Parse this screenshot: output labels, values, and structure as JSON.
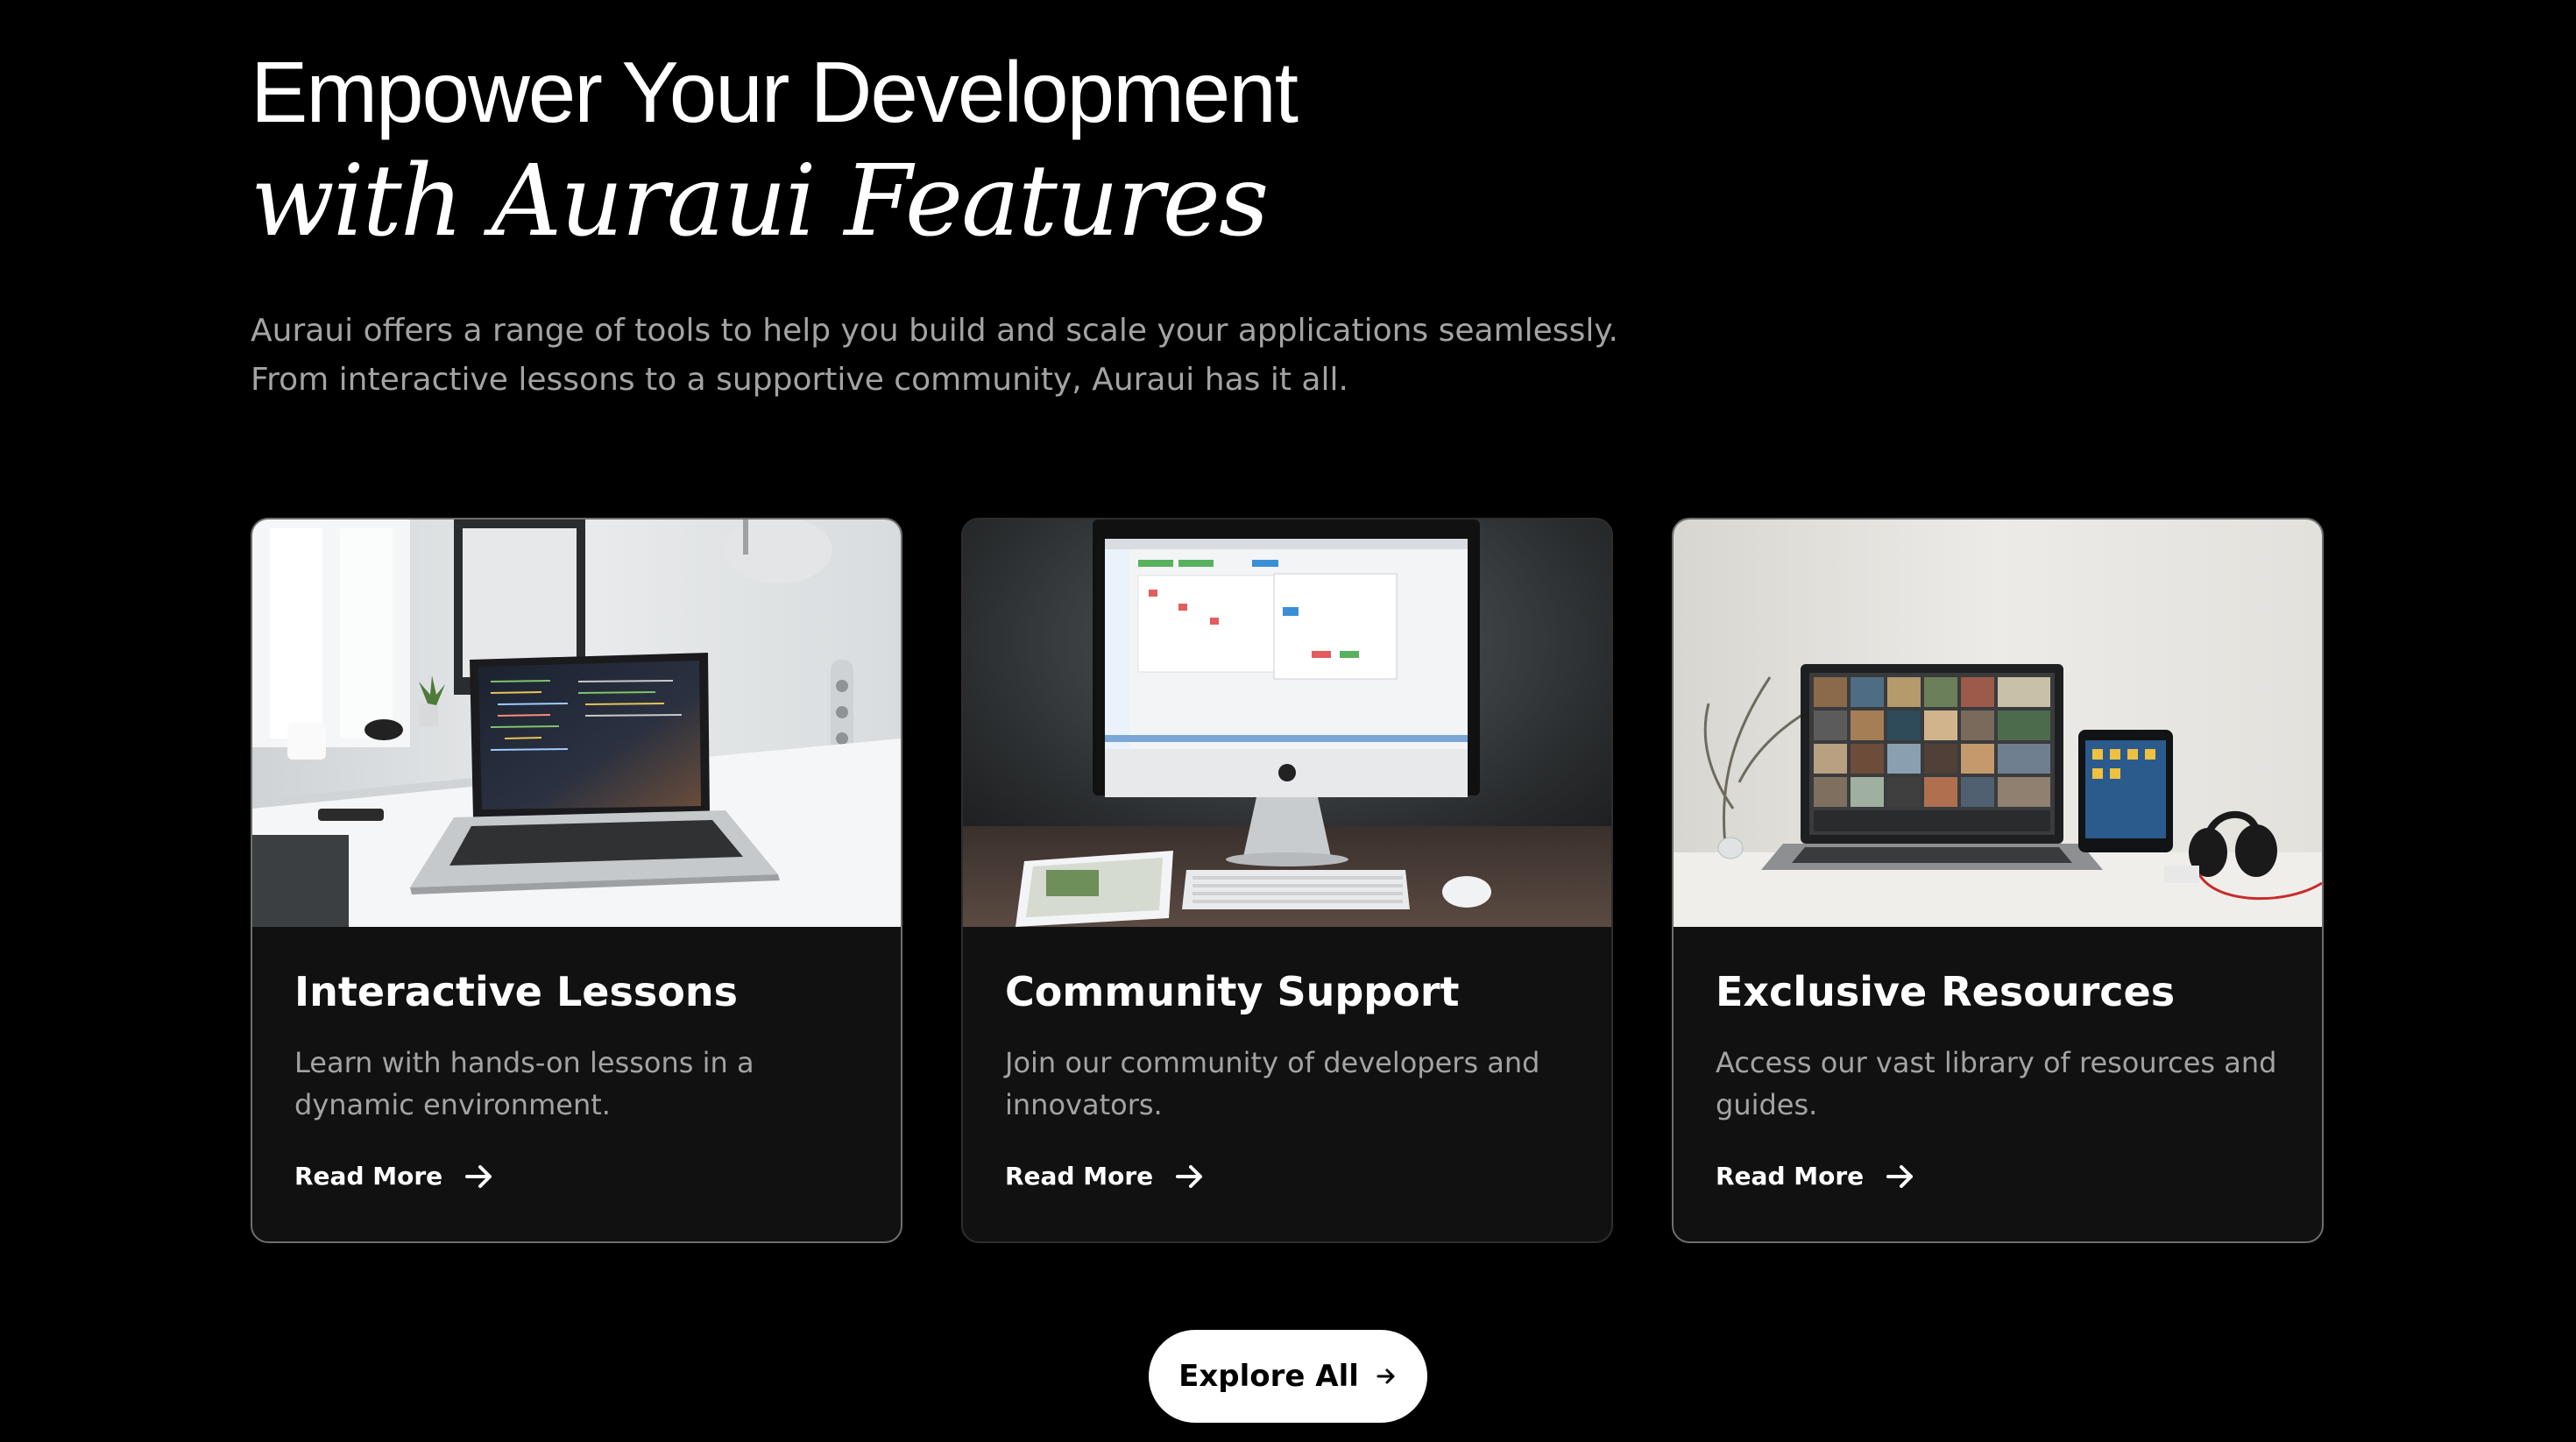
{
  "section": {
    "heading_line1": "Empower Your Development",
    "heading_line2": "with Auraui Features",
    "intro_line1": "Auraui offers a range of tools to help you build and scale your applications seamlessly.",
    "intro_line2": "From interactive lessons to a supportive community, Auraui has it all."
  },
  "cards": [
    {
      "title": "Interactive Lessons",
      "description": "Learn with hands-on lessons in a dynamic environment.",
      "link_label": "Read More",
      "image": "laptop-with-code-photo",
      "icon": "arrow-right-icon"
    },
    {
      "title": "Community Support",
      "description": "Join our community of developers and innovators.",
      "link_label": "Read More",
      "image": "desktop-computer-photo",
      "icon": "arrow-right-icon"
    },
    {
      "title": "Exclusive Resources",
      "description": "Access our vast library of resources and guides.",
      "link_label": "Read More",
      "image": "laptop-and-tablet-photo",
      "icon": "arrow-right-icon"
    }
  ],
  "explore_button": {
    "label": "Explore All",
    "icon": "arrow-right-icon"
  },
  "colors": {
    "background": "#000000",
    "card_background": "#111111",
    "card_border": "#6e6e6e",
    "muted_text": "#a3a3a3",
    "button_background": "#ffffff",
    "button_text": "#000000"
  }
}
